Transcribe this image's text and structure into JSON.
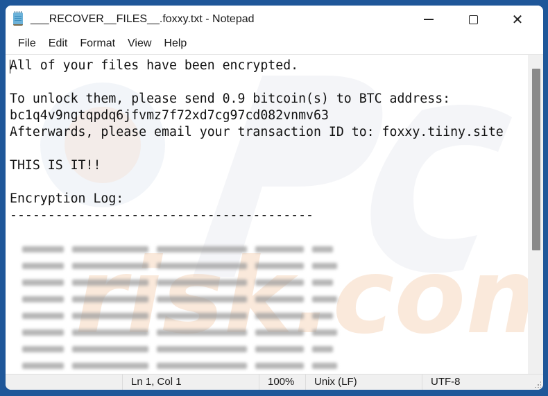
{
  "window": {
    "title": "___RECOVER__FILES__.foxxy.txt - Notepad",
    "app_icon": "notepad-icon",
    "controls": {
      "minimize": "minimize-icon",
      "maximize": "maximize-icon",
      "close": "close-icon"
    }
  },
  "menu": {
    "items": [
      {
        "label": "File"
      },
      {
        "label": "Edit"
      },
      {
        "label": "Format"
      },
      {
        "label": "View"
      },
      {
        "label": "Help"
      }
    ]
  },
  "document": {
    "lines": [
      "All of your files have been encrypted.",
      "",
      "To unlock them, please send 0.9 bitcoin(s) to BTC address:",
      "bc1q4v9ngtqpdq6jfvmz7f72xd7cg97cd082vnmv63",
      "Afterwards, please email your transaction ID to: foxxy.tiiny.site",
      "",
      "THIS IS IT!!",
      "",
      "Encryption Log:",
      "----------------------------------------"
    ],
    "log_redacted": true,
    "log_row_count": 8
  },
  "scrollbar": {
    "position_fraction": 0.0,
    "visible_fraction": 0.62
  },
  "statusbar": {
    "position": "Ln 1, Col 1",
    "zoom": "100%",
    "line_ending": "Unix (LF)",
    "encoding": "UTF-8"
  },
  "colors": {
    "desktop": "#1f5799",
    "scroll_thumb": "#8a8a8a",
    "statusbar_bg": "#f0f0f0"
  }
}
